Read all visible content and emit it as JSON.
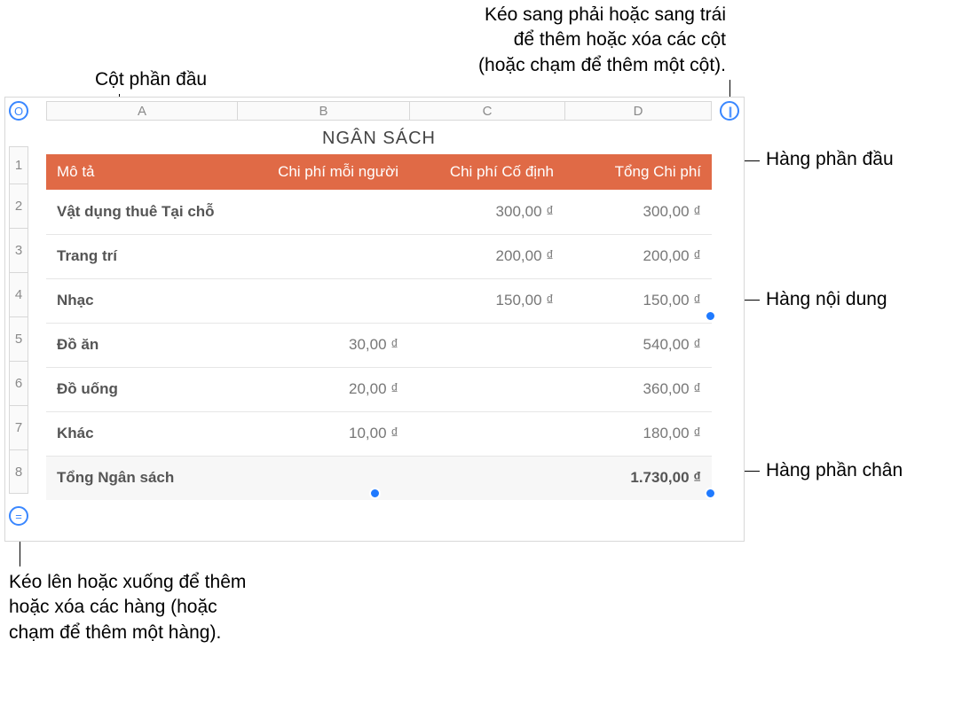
{
  "callouts": {
    "top_left": "Cột phần đầu",
    "top_right_l1": "Kéo sang phải hoặc sang trái",
    "top_right_l2": "để thêm hoặc xóa các cột",
    "top_right_l3": "(hoặc chạm để thêm một cột).",
    "right_header": "Hàng phần đầu",
    "right_body": "Hàng nội dung",
    "right_footer": "Hàng phần chân",
    "bottom_l1": "Kéo lên hoặc xuống để thêm",
    "bottom_l2": "hoặc xóa các hàng (hoặc",
    "bottom_l3": "chạm để thêm một hàng)."
  },
  "controls": {
    "table_handle": "O",
    "add_column": "||",
    "add_row": "="
  },
  "columns": [
    "A",
    "B",
    "C",
    "D"
  ],
  "row_nums": [
    "1",
    "2",
    "3",
    "4",
    "5",
    "6",
    "7",
    "8"
  ],
  "table_title": "NGÂN SÁCH",
  "headers": {
    "desc": "Mô tả",
    "per_person": "Chi phí mỗi người",
    "fixed": "Chi phí Cố định",
    "total": "Tổng Chi phí"
  },
  "rows": [
    {
      "desc": "Vật dụng thuê Tại chỗ",
      "per_person": "",
      "fixed": "300,00 ₫",
      "total": "300,00 ₫"
    },
    {
      "desc": "Trang trí",
      "per_person": "",
      "fixed": "200,00 ₫",
      "total": "200,00 ₫"
    },
    {
      "desc": "Nhạc",
      "per_person": "",
      "fixed": "150,00 ₫",
      "total": "150,00 ₫"
    },
    {
      "desc": "Đồ ăn",
      "per_person": "30,00 ₫",
      "fixed": "",
      "total": "540,00 ₫"
    },
    {
      "desc": "Đồ uống",
      "per_person": "20,00 ₫",
      "fixed": "",
      "total": "360,00 ₫"
    },
    {
      "desc": "Khác",
      "per_person": "10,00 ₫",
      "fixed": "",
      "total": "180,00 ₫"
    }
  ],
  "footer": {
    "desc": "Tổng Ngân sách",
    "per_person": "",
    "fixed": "",
    "total": "1.730,00 ₫"
  },
  "colors": {
    "header_bg": "#e06a46",
    "accent": "#1f7aff"
  }
}
